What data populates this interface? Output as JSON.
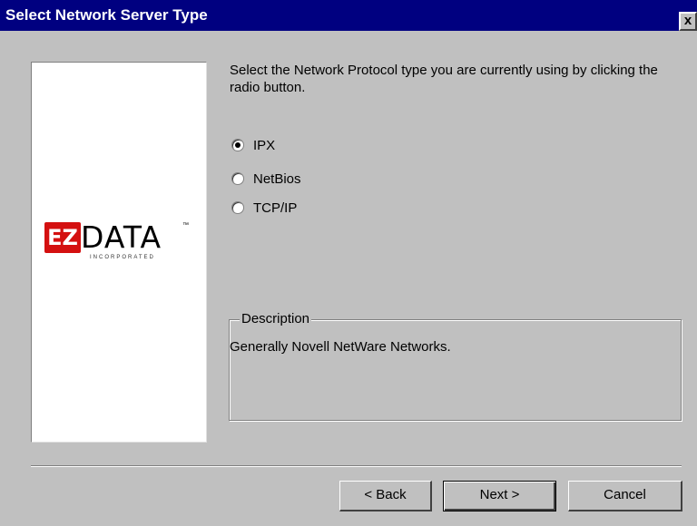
{
  "dialog": {
    "title": "Select Network Server Type",
    "close_label": "x"
  },
  "logo": {
    "brand_mark": "EZ",
    "wordmark": "DATA",
    "trademark": "™",
    "tagline": "INCORPORATED"
  },
  "instructions": "Select the Network Protocol type you are currently using by clicking the radio button.",
  "protocols": {
    "selected": "IPX",
    "options": [
      {
        "label": "IPX",
        "checked": true
      },
      {
        "label": "NetBios",
        "checked": false
      },
      {
        "label": "TCP/IP",
        "checked": false
      }
    ]
  },
  "description": {
    "legend": "Description",
    "text": "Generally Novell NetWare Networks."
  },
  "buttons": {
    "back": "< Back",
    "next": "Next >",
    "cancel": "Cancel"
  }
}
